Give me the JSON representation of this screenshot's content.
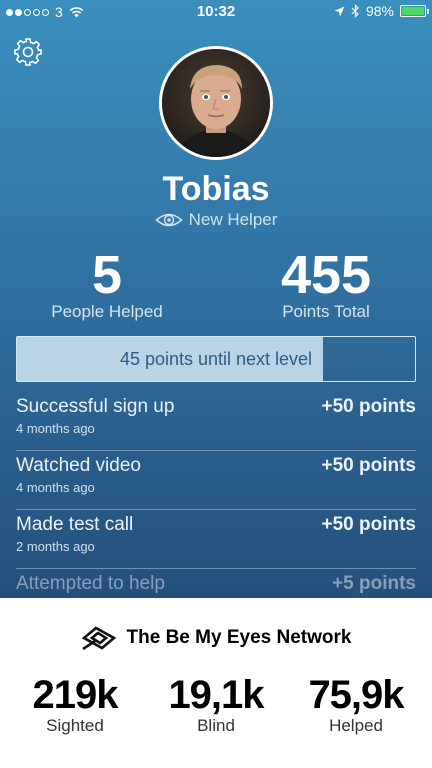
{
  "status_bar": {
    "carrier": "3",
    "time": "10:32",
    "battery": "98%",
    "battery_level": 0.98,
    "signal_bars_filled": 2,
    "signal_bars_total": 5
  },
  "profile": {
    "name": "Tobias",
    "level_label": "New Helper",
    "people_helped": "5",
    "people_helped_label": "People Helped",
    "points_total": "455",
    "points_total_label": "Points Total"
  },
  "progress": {
    "text": "45 points until next level",
    "fraction": 0.77
  },
  "activities": [
    {
      "title": "Successful sign up",
      "date": "4 months ago",
      "points": "+50 points"
    },
    {
      "title": "Watched video",
      "date": "4 months ago",
      "points": "+50 points"
    },
    {
      "title": "Made test call",
      "date": "2 months ago",
      "points": "+50 points"
    },
    {
      "title": "Attempted to help",
      "date": "",
      "points": "+5 points"
    }
  ],
  "network": {
    "title": "The Be My Eyes Network",
    "sighted": "219k",
    "sighted_label": "Sighted",
    "blind": "19,1k",
    "blind_label": "Blind",
    "helped": "75,9k",
    "helped_label": "Helped"
  },
  "colors": {
    "gradient_top": "#3a8fbd",
    "gradient_bottom": "#24507b",
    "battery_green": "#4cd964"
  },
  "icons": [
    "gear-icon",
    "eye-icon",
    "location-arrow-icon",
    "bluetooth-icon",
    "wifi-icon",
    "be-my-eyes-logo-icon"
  ]
}
